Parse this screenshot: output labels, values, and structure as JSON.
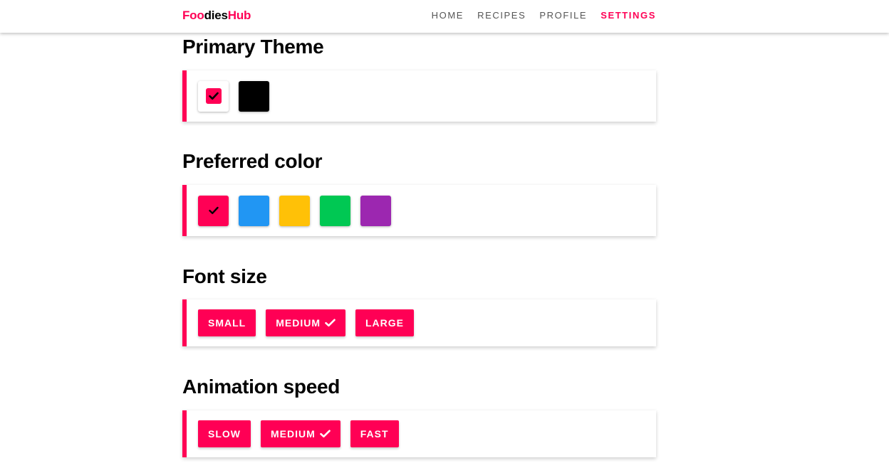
{
  "brand": {
    "part1": "Foo",
    "part2": "dies",
    "part3": "Hub",
    "accent_color": "#ff0055"
  },
  "nav": {
    "items": [
      {
        "label": "HOME",
        "active": false
      },
      {
        "label": "RECIPES",
        "active": false
      },
      {
        "label": "PROFILE",
        "active": false
      },
      {
        "label": "SETTINGS",
        "active": true
      }
    ]
  },
  "sections": {
    "primary_theme": {
      "title": "Primary Theme",
      "options": [
        {
          "name": "light",
          "color": "#ffffff",
          "selected": true
        },
        {
          "name": "dark",
          "color": "#000000",
          "selected": false
        }
      ]
    },
    "preferred_color": {
      "title": "Preferred color",
      "options": [
        {
          "color": "#ff0055",
          "selected": true
        },
        {
          "color": "#2196f3",
          "selected": false
        },
        {
          "color": "#ffc107",
          "selected": false
        },
        {
          "color": "#00c853",
          "selected": false
        },
        {
          "color": "#9c27b0",
          "selected": false
        }
      ]
    },
    "font_size": {
      "title": "Font size",
      "options": [
        {
          "label": "SMALL",
          "selected": false
        },
        {
          "label": "MEDIUM",
          "selected": true
        },
        {
          "label": "LARGE",
          "selected": false
        }
      ]
    },
    "animation_speed": {
      "title": "Animation speed",
      "options": [
        {
          "label": "SLOW",
          "selected": false
        },
        {
          "label": "MEDIUM",
          "selected": true
        },
        {
          "label": "FAST",
          "selected": false
        }
      ]
    }
  },
  "icons": {
    "selected": "check-icon"
  }
}
